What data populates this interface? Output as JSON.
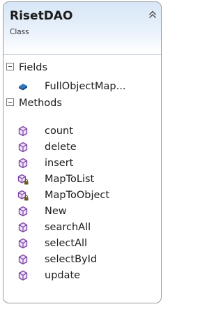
{
  "class_shape": {
    "name": "RisetDAO",
    "stereotype": "Class",
    "collapse_icon": "double-chevron-up-icon"
  },
  "fields_section": {
    "label": "Fields",
    "items": [
      {
        "label": "FullObjectMap...",
        "icon": "field-icon"
      }
    ]
  },
  "methods_section": {
    "label": "Methods",
    "items": [
      {
        "label": "count",
        "icon": "method-icon"
      },
      {
        "label": "delete",
        "icon": "method-icon"
      },
      {
        "label": "insert",
        "icon": "method-icon"
      },
      {
        "label": "MapToList",
        "icon": "private-method-icon"
      },
      {
        "label": "MapToObject",
        "icon": "private-method-icon"
      },
      {
        "label": "New",
        "icon": "method-icon"
      },
      {
        "label": "searchAll",
        "icon": "method-icon"
      },
      {
        "label": "selectAll",
        "icon": "method-icon"
      },
      {
        "label": "selectById",
        "icon": "method-icon"
      },
      {
        "label": "update",
        "icon": "method-icon"
      }
    ]
  },
  "colors": {
    "header_gradient_top": "#d7e6f6",
    "method_icon": "#7b3fa8",
    "field_icon": "#1f5fa8",
    "lock": "#6b5a20"
  }
}
